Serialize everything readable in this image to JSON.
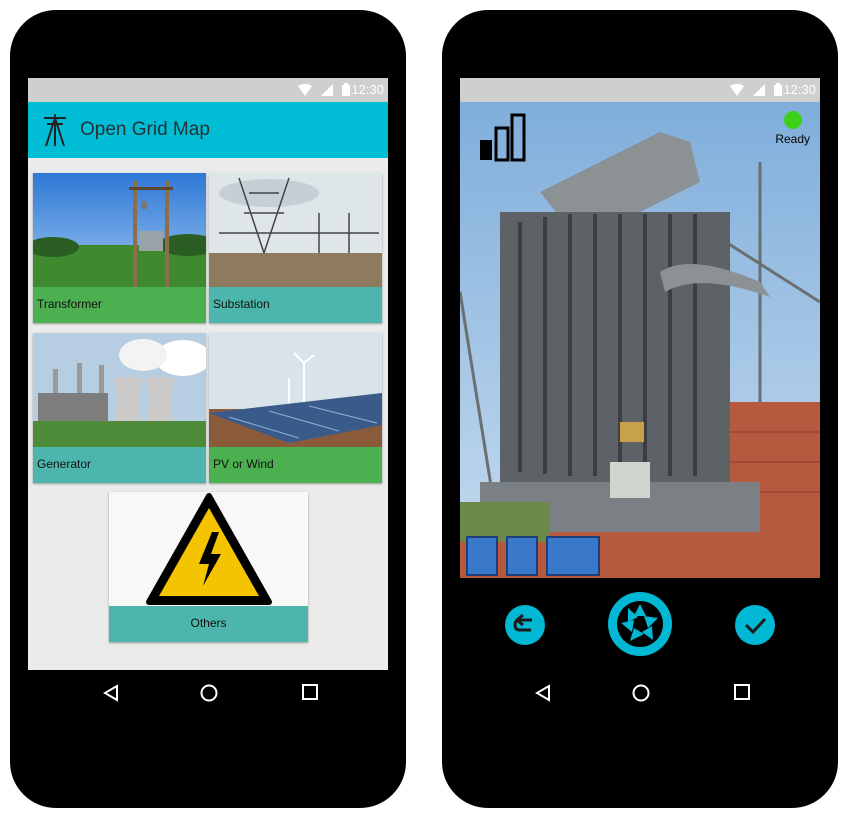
{
  "status": {
    "time": "12:30"
  },
  "left": {
    "app_title": "Open Grid Map",
    "categories": [
      {
        "label": "Transformer"
      },
      {
        "label": "Substation"
      },
      {
        "label": "Generator"
      },
      {
        "label": "PV or Wind"
      },
      {
        "label": "Others"
      }
    ]
  },
  "right": {
    "ready_label": "Ready"
  },
  "colors": {
    "app_bar": "#00bcd4",
    "label_green": "#4caf50",
    "label_teal": "#4db6ac",
    "accent_cyan": "#00b8d4",
    "ready_green": "#3cd01a"
  },
  "icons": {
    "app_logo": "power-pole-icon",
    "status": [
      "wifi-icon",
      "signal-icon",
      "battery-icon"
    ],
    "nav": [
      "back-triangle-icon",
      "home-circle-icon",
      "recents-square-icon"
    ],
    "camera": [
      "signal-strength-bars-icon",
      "undo-icon",
      "shutter-icon",
      "check-icon"
    ]
  }
}
